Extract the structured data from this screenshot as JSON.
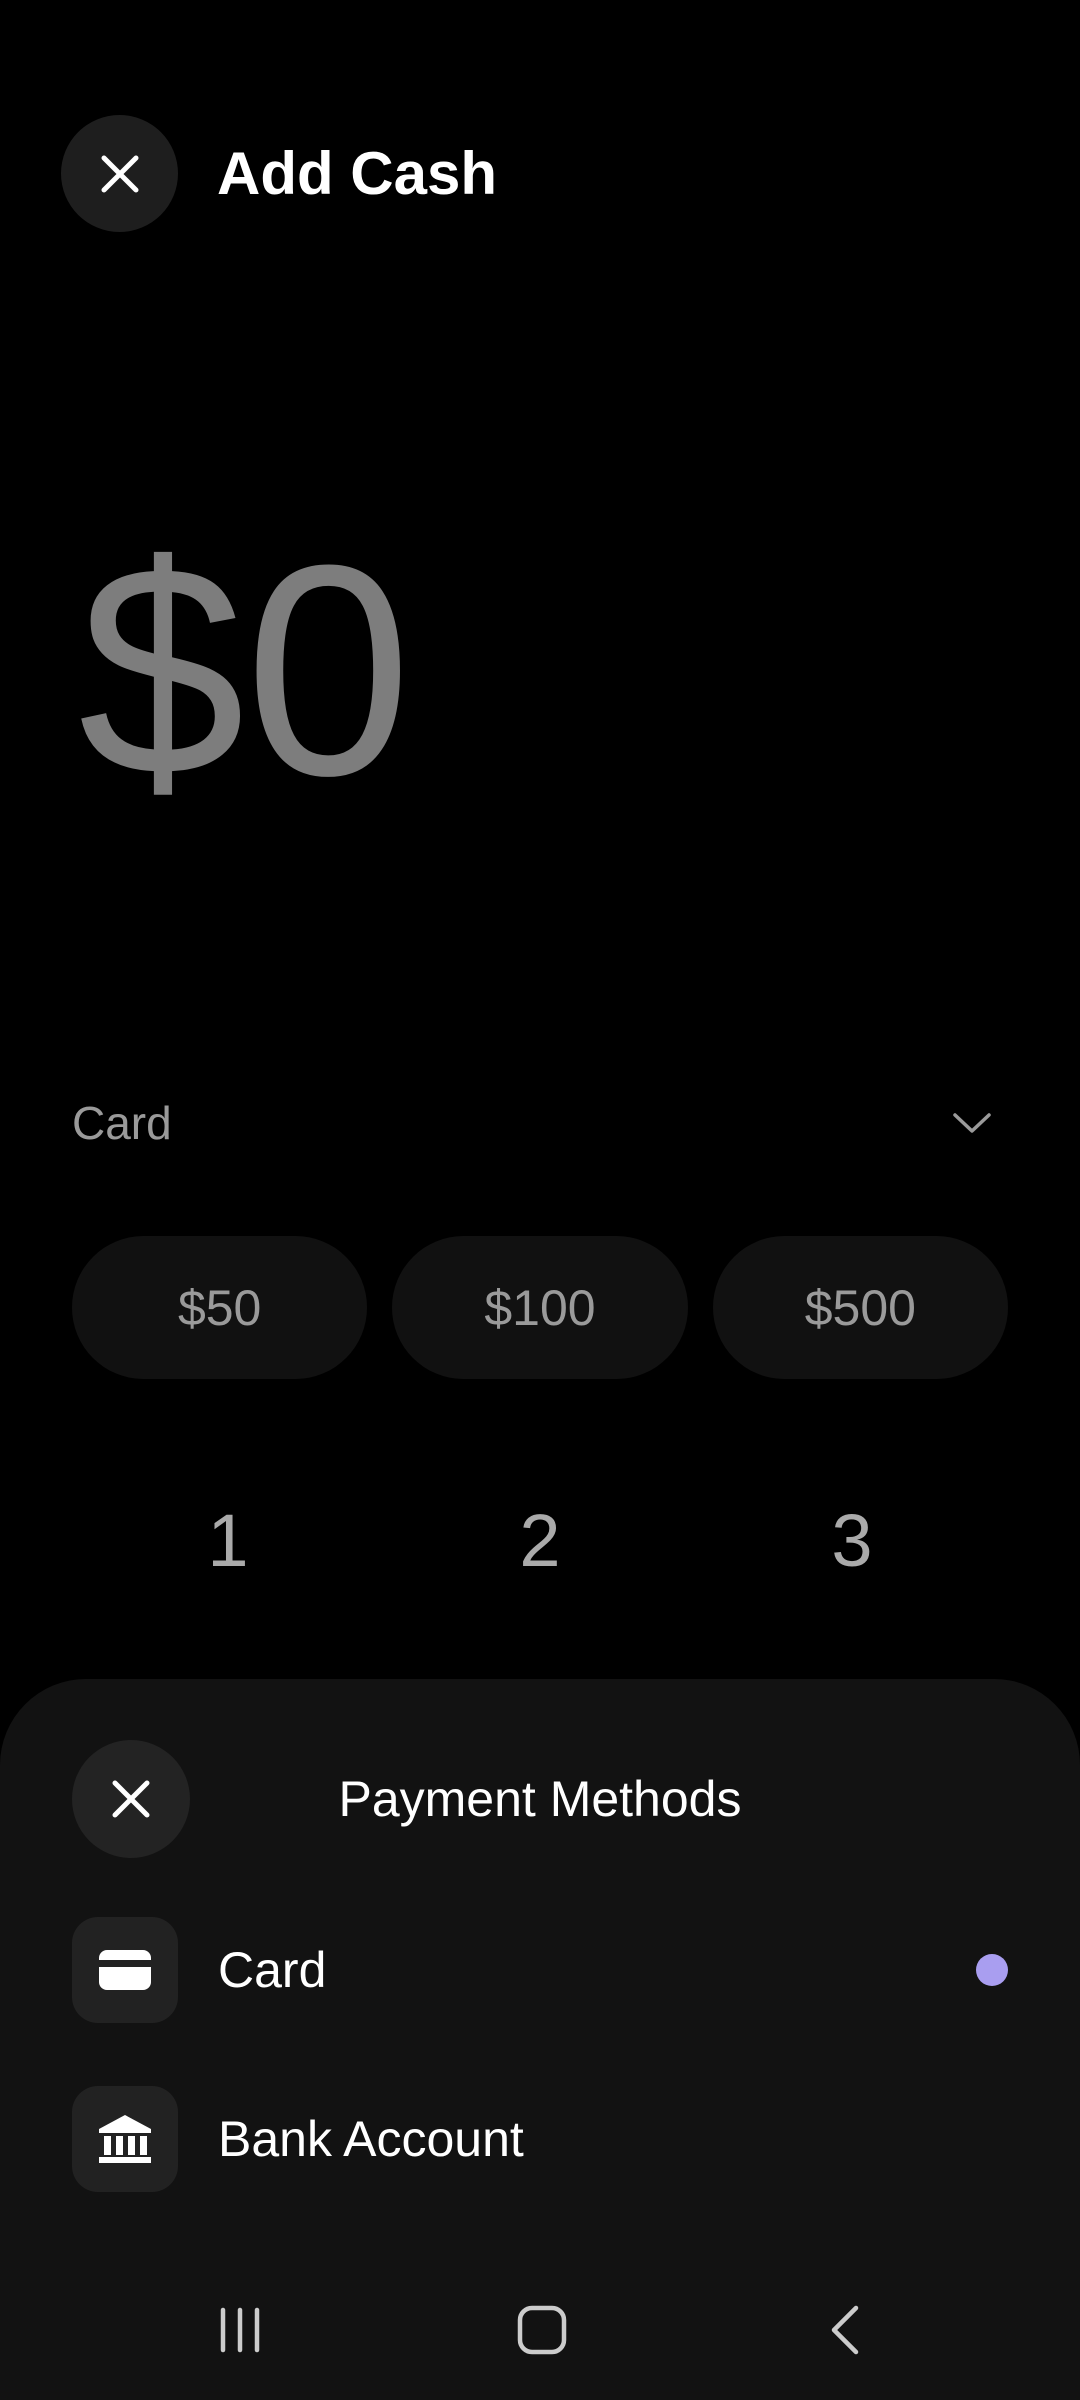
{
  "header": {
    "title": "Add Cash",
    "close_icon": "close-icon"
  },
  "amount": {
    "value": "$0"
  },
  "payment_selector": {
    "label": "Card",
    "chevron_icon": "chevron-down-icon"
  },
  "quick_amounts": [
    "$50",
    "$100",
    "$500"
  ],
  "keypad": {
    "visible_keys": [
      "1",
      "2",
      "3"
    ]
  },
  "sheet": {
    "title": "Payment Methods",
    "close_icon": "close-icon",
    "options": [
      {
        "label": "Card",
        "icon": "credit-card-icon",
        "selected": true
      },
      {
        "label": "Bank Account",
        "icon": "bank-icon",
        "selected": false
      }
    ]
  },
  "colors": {
    "background": "#000000",
    "sheet_background": "#121212",
    "selected_dot": "#a99ef0",
    "muted_text": "#9a9a9a",
    "amount_text": "#7d7d7d"
  },
  "navbar": {
    "icons": [
      "recent-apps-icon",
      "home-icon",
      "back-icon"
    ]
  }
}
